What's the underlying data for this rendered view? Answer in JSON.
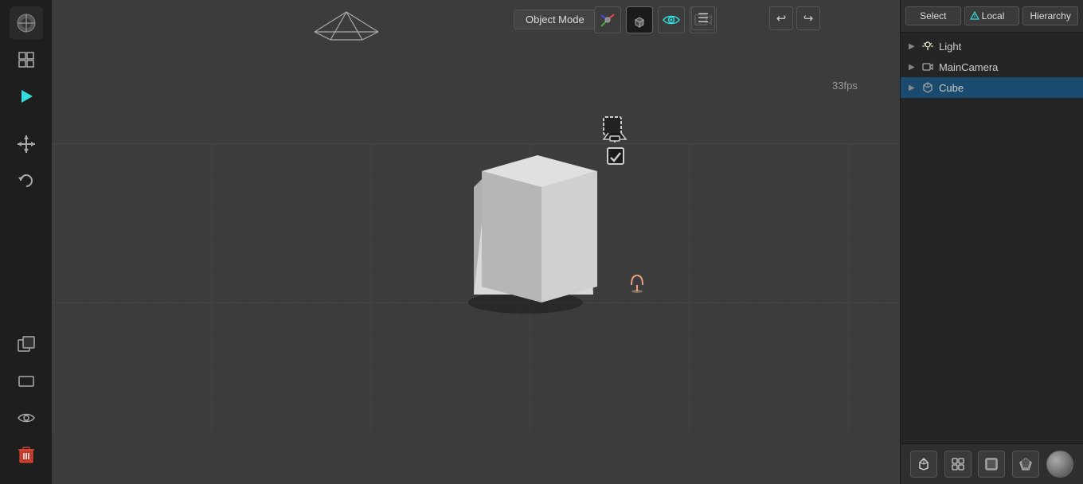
{
  "viewport": {
    "mode_label": "Object Mode",
    "fps": "33fps",
    "background_color": "#3c3c3c"
  },
  "top_toolbar": {
    "blender_icon": "⬡",
    "outliner_icon": "▣",
    "play_icon": "▶"
  },
  "left_toolbar": {
    "move_icon": "✛",
    "refresh_icon": "↺",
    "duplicate_icon": "⧉",
    "frame_icon": "▭",
    "eye_icon": "👁",
    "delete_icon": "🗑"
  },
  "top_right_toolbar": {
    "axis_gizmo_label": "axis-gizmo",
    "view_cube_label": "view-cube",
    "camera_view_label": "camera-view",
    "render_label": "render",
    "undo_label": "undo",
    "redo_label": "redo",
    "menu_label": "menu"
  },
  "right_panel": {
    "select_label": "Select",
    "local_label": "Local",
    "hierarchy_label": "Hierarchy",
    "items": [
      {
        "id": "light",
        "label": "Light",
        "icon": "light",
        "selected": false
      },
      {
        "id": "main-camera",
        "label": "MainCamera",
        "icon": "camera",
        "selected": false
      },
      {
        "id": "cube",
        "label": "Cube",
        "icon": "cube",
        "selected": true
      }
    ],
    "bottom_icons": [
      {
        "id": "scene",
        "icon": "▣"
      },
      {
        "id": "layers",
        "icon": "⊞"
      },
      {
        "id": "object",
        "icon": "⬡"
      },
      {
        "id": "modifier",
        "icon": "⚙"
      },
      {
        "id": "material",
        "icon": "●"
      }
    ]
  }
}
